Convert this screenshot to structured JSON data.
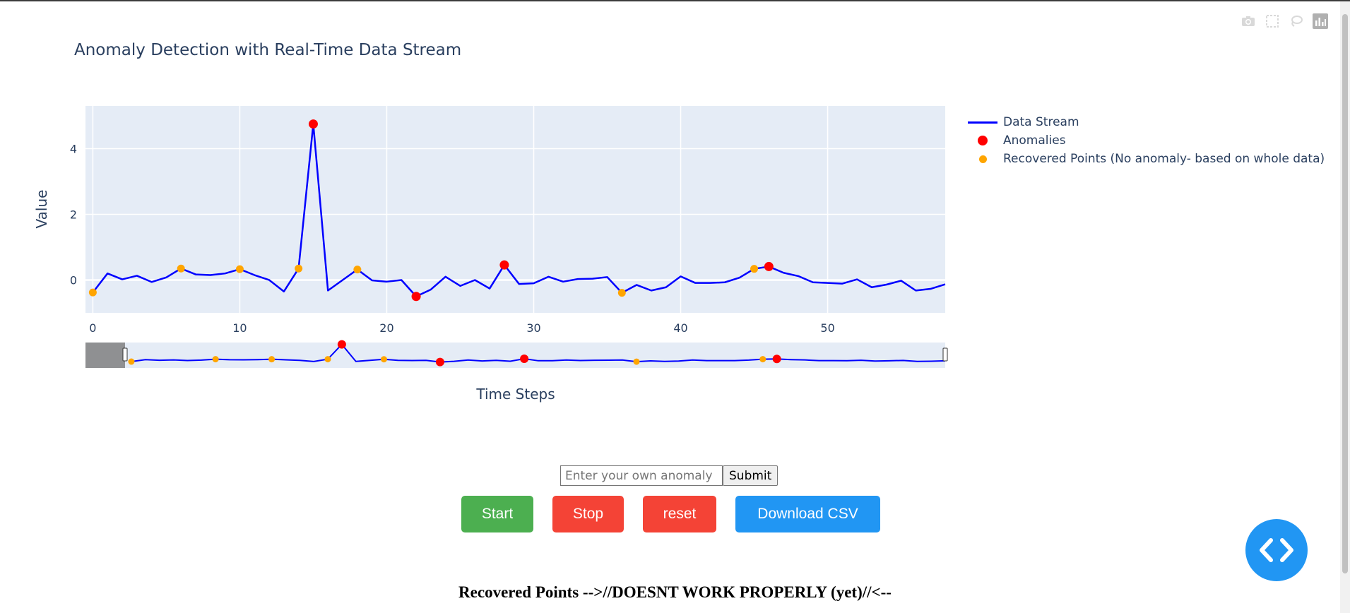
{
  "page": {
    "bottom_text": "Recovered Points -->//DOESNT WORK PROPERLY (yet)//<--"
  },
  "form": {
    "placeholder": "Enter your own anomaly",
    "submit_label": "Submit"
  },
  "controls": {
    "start_label": "Start",
    "stop_label": "Stop",
    "reset_label": "reset",
    "csv_label": "Download CSV"
  },
  "icons": {
    "modebar": [
      "camera-icon",
      "box-select-icon",
      "lasso-icon",
      "plotly-logo-icon"
    ],
    "fab": "code-icon"
  },
  "colors": {
    "line": "#0000ff",
    "anomaly": "#ff0000",
    "recovered": "#ffa500",
    "plot_bg": "#e5ecf6",
    "start": "#4caf50",
    "stop": "#f44336",
    "csv": "#2196f3"
  },
  "chart_data": {
    "type": "line",
    "title": "Anomaly Detection with Real-Time Data Stream",
    "xlabel": "Time Steps",
    "ylabel": "Value",
    "xlim": [
      -0.5,
      58
    ],
    "ylim": [
      -1.0,
      5.3
    ],
    "x_ticks": [
      0,
      10,
      20,
      30,
      40,
      50
    ],
    "y_ticks": [
      0,
      2,
      4
    ],
    "grid": true,
    "legend_position": "right",
    "range_slider": true,
    "series": [
      {
        "name": "Data Stream",
        "mode": "line",
        "color": "#0000ff",
        "x": [
          0,
          1,
          2,
          3,
          4,
          5,
          6,
          7,
          8,
          9,
          10,
          11,
          12,
          13,
          14,
          15,
          16,
          17,
          18,
          19,
          20,
          21,
          22,
          23,
          24,
          25,
          26,
          27,
          28,
          29,
          30,
          31,
          32,
          33,
          34,
          35,
          36,
          37,
          38,
          39,
          40,
          41,
          42,
          43,
          44,
          45,
          46,
          47,
          48,
          49,
          50,
          51,
          52,
          53,
          54,
          55,
          56,
          57,
          58
        ],
        "y": [
          -0.38,
          0.2,
          0.02,
          0.13,
          -0.06,
          0.08,
          0.35,
          0.17,
          0.15,
          0.2,
          0.33,
          0.15,
          0.0,
          -0.35,
          0.35,
          4.75,
          -0.32,
          0.0,
          0.32,
          -0.01,
          -0.05,
          0.0,
          -0.5,
          -0.29,
          0.1,
          -0.18,
          0.0,
          -0.26,
          0.46,
          -0.12,
          -0.1,
          0.1,
          -0.05,
          0.03,
          0.04,
          0.09,
          -0.39,
          -0.15,
          -0.32,
          -0.22,
          0.11,
          -0.09,
          -0.09,
          -0.07,
          0.07,
          0.34,
          0.41,
          0.22,
          0.12,
          -0.07,
          -0.09,
          -0.11,
          0.02,
          -0.22,
          -0.14,
          -0.02,
          -0.32,
          -0.27,
          -0.13
        ]
      },
      {
        "name": "Anomalies",
        "mode": "markers",
        "color": "#ff0000",
        "x": [
          15,
          22,
          28,
          46
        ],
        "y": [
          4.75,
          -0.5,
          0.46,
          0.41
        ]
      },
      {
        "name": "Recovered Points (No anomaly- based on whole data)",
        "mode": "markers",
        "color": "#ffa500",
        "x": [
          0,
          6,
          10,
          14,
          18,
          36,
          45
        ],
        "y": [
          -0.38,
          0.35,
          0.33,
          0.35,
          0.32,
          -0.39,
          0.34
        ]
      }
    ]
  }
}
